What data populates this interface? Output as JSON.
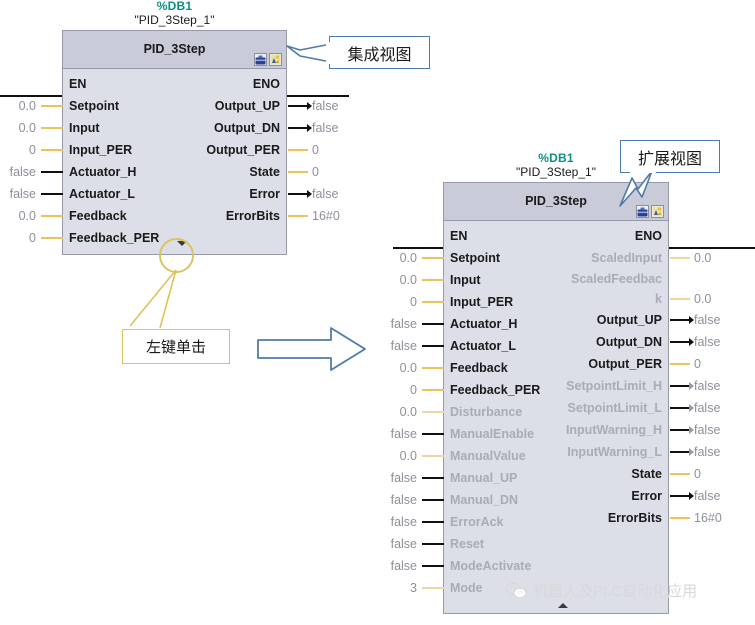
{
  "integrated_block": {
    "db_label": "%DB1",
    "instance_label": "\"PID_3Step_1\"",
    "title": "PID_3Step",
    "icons": [
      "toolbox-icon",
      "diagnostics-icon"
    ],
    "en_label": "EN",
    "eno_label": "ENO",
    "inputs": [
      {
        "name": "Setpoint",
        "value": "0.0",
        "wire": "yellow",
        "dim": false
      },
      {
        "name": "Input",
        "value": "0.0",
        "wire": "yellow",
        "dim": false
      },
      {
        "name": "Input_PER",
        "value": "0",
        "wire": "yellow",
        "dim": false
      },
      {
        "name": "Actuator_H",
        "value": "false",
        "wire": "black",
        "dim": false
      },
      {
        "name": "Actuator_L",
        "value": "false",
        "wire": "black",
        "dim": false
      },
      {
        "name": "Feedback",
        "value": "0.0",
        "wire": "yellow",
        "dim": false
      },
      {
        "name": "Feedback_PER",
        "value": "0",
        "wire": "yellow",
        "dim": false
      }
    ],
    "outputs": [
      {
        "name": "Output_UP",
        "value": "false",
        "wire": "black",
        "dim": false
      },
      {
        "name": "Output_DN",
        "value": "false",
        "wire": "black",
        "dim": false
      },
      {
        "name": "Output_PER",
        "value": "0",
        "wire": "yellow",
        "dim": false
      },
      {
        "name": "State",
        "value": "0",
        "wire": "yellow",
        "dim": false
      },
      {
        "name": "Error",
        "value": "false",
        "wire": "black",
        "dim": false
      },
      {
        "name": "ErrorBits",
        "value": "16#0",
        "wire": "yellow",
        "dim": false
      }
    ],
    "expander": "chevron-down-icon"
  },
  "expanded_block": {
    "db_label": "%DB1",
    "instance_label": "\"PID_3Step_1\"",
    "title": "PID_3Step",
    "icons": [
      "toolbox-icon",
      "diagnostics-icon"
    ],
    "en_label": "EN",
    "eno_label": "ENO",
    "inputs": [
      {
        "name": "Setpoint",
        "value": "0.0",
        "wire": "yellow",
        "dim": false
      },
      {
        "name": "Input",
        "value": "0.0",
        "wire": "yellow",
        "dim": false
      },
      {
        "name": "Input_PER",
        "value": "0",
        "wire": "yellow",
        "dim": false
      },
      {
        "name": "Actuator_H",
        "value": "false",
        "wire": "black",
        "dim": false
      },
      {
        "name": "Actuator_L",
        "value": "false",
        "wire": "black",
        "dim": false
      },
      {
        "name": "Feedback",
        "value": "0.0",
        "wire": "yellow",
        "dim": false
      },
      {
        "name": "Feedback_PER",
        "value": "0",
        "wire": "yellow",
        "dim": false
      },
      {
        "name": "Disturbance",
        "value": "0.0",
        "wire": "dim-yellow",
        "dim": true
      },
      {
        "name": "ManualEnable",
        "value": "false",
        "wire": "black",
        "dim": true
      },
      {
        "name": "ManualValue",
        "value": "0.0",
        "wire": "dim-yellow",
        "dim": true
      },
      {
        "name": "Manual_UP",
        "value": "false",
        "wire": "black",
        "dim": true
      },
      {
        "name": "Manual_DN",
        "value": "false",
        "wire": "black",
        "dim": true
      },
      {
        "name": "ErrorAck",
        "value": "false",
        "wire": "black",
        "dim": true
      },
      {
        "name": "Reset",
        "value": "false",
        "wire": "black",
        "dim": true
      },
      {
        "name": "ModeActivate",
        "value": "false",
        "wire": "black",
        "dim": true
      },
      {
        "name": "Mode",
        "value": "3",
        "wire": "dim-yellow",
        "dim": true
      }
    ],
    "outputs": [
      {
        "name": "ScaledInput",
        "value": "0.0",
        "wire": "dim-yellow",
        "dim": true
      },
      {
        "name": "ScaledFeedbac",
        "value": "",
        "wire": "none",
        "dim": true
      },
      {
        "name": "k",
        "value": "0.0",
        "wire": "dim-yellow",
        "dim": true
      },
      {
        "name": "Output_UP",
        "value": "false",
        "wire": "black",
        "dim": false
      },
      {
        "name": "Output_DN",
        "value": "false",
        "wire": "black",
        "dim": false
      },
      {
        "name": "Output_PER",
        "value": "0",
        "wire": "yellow",
        "dim": false
      },
      {
        "name": "SetpointLimit_H",
        "value": "false",
        "wire": "black",
        "dim": true
      },
      {
        "name": "SetpointLimit_L",
        "value": "false",
        "wire": "black",
        "dim": true
      },
      {
        "name": "InputWarning_H",
        "value": "false",
        "wire": "black",
        "dim": true
      },
      {
        "name": "InputWarning_L",
        "value": "false",
        "wire": "black",
        "dim": true
      },
      {
        "name": "State",
        "value": "0",
        "wire": "yellow",
        "dim": false
      },
      {
        "name": "Error",
        "value": "false",
        "wire": "black",
        "dim": false
      },
      {
        "name": "ErrorBits",
        "value": "16#0",
        "wire": "yellow",
        "dim": false
      }
    ],
    "collapser": "chevron-up-icon"
  },
  "callouts": {
    "integrated_view": "集成视图",
    "expanded_view": "扩展视图"
  },
  "note": {
    "text": "左键单击",
    "highlight": "click-target-circle"
  },
  "transition_arrow": "right-arrow-shape",
  "watermark": {
    "logo": "wechat-icon",
    "text": "机器人及PLC自动化应用"
  },
  "colors": {
    "db_teal": "#0a9184",
    "block_header": "#c9cbd9",
    "block_body": "#dcdee8",
    "block_border": "#9699a8",
    "wire_yellow": "#e8c45b",
    "wire_black": "#101010",
    "value_gray": "#8e9099",
    "dim_label": "#a9abb6",
    "callout_border": "#4f7ba8",
    "note_border": "#dcc45c"
  }
}
